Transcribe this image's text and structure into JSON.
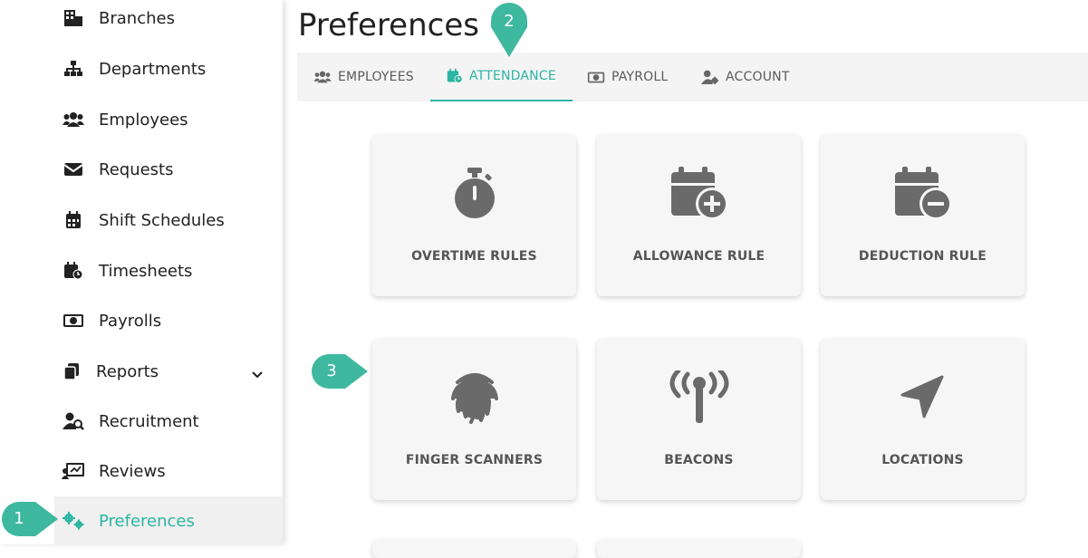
{
  "sidebar": {
    "items": [
      {
        "label": "Branches",
        "icon": "building-icon"
      },
      {
        "label": "Departments",
        "icon": "sitemap-icon"
      },
      {
        "label": "Employees",
        "icon": "users-icon"
      },
      {
        "label": "Requests",
        "icon": "envelope-icon"
      },
      {
        "label": "Shift Schedules",
        "icon": "calendar-icon"
      },
      {
        "label": "Timesheets",
        "icon": "calendar-clock-icon"
      },
      {
        "label": "Payrolls",
        "icon": "money-icon"
      },
      {
        "label": "Reports",
        "icon": "copy-icon"
      },
      {
        "label": "Recruitment",
        "icon": "user-search-icon"
      },
      {
        "label": "Reviews",
        "icon": "chalkboard-icon"
      },
      {
        "label": "Preferences",
        "icon": "cogs-icon"
      }
    ]
  },
  "header": {
    "title": "Preferences"
  },
  "tabs": [
    {
      "label": "EMPLOYEES"
    },
    {
      "label": "ATTENDANCE"
    },
    {
      "label": "PAYROLL"
    },
    {
      "label": "ACCOUNT"
    }
  ],
  "cards": [
    {
      "label": "OVERTIME RULES",
      "icon": "stopwatch-icon"
    },
    {
      "label": "ALLOWANCE RULE",
      "icon": "calendar-plus-icon"
    },
    {
      "label": "DEDUCTION RULE",
      "icon": "calendar-minus-icon"
    },
    {
      "label": "FINGER SCANNERS",
      "icon": "fingerprint-icon"
    },
    {
      "label": "BEACONS",
      "icon": "broadcast-tower-icon"
    },
    {
      "label": "LOCATIONS",
      "icon": "location-arrow-icon"
    }
  ],
  "markers": [
    "1",
    "2",
    "3"
  ],
  "colors": {
    "accent": "#2bb6a3",
    "marker": "#3fb8a0"
  }
}
